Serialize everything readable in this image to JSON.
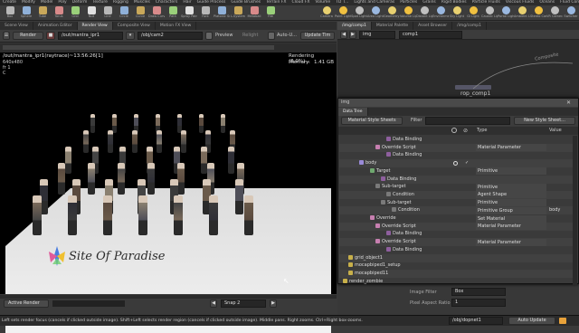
{
  "shelf_tabs": [
    "Create",
    "Modify",
    "Model",
    "Poly",
    "Deform",
    "Texture",
    "Rigging",
    "Muscles",
    "Characters",
    "Hair",
    "Guide Process",
    "Guide Brushes",
    "Terrain FX",
    "Cloud FX",
    "Volume",
    "TD T...",
    "Lights and Cameras",
    "Particles",
    "Grains",
    "Rigid Bodies",
    "Particle Fluids",
    "Viscous Fluids",
    "Oceans",
    "Fluid Containers",
    "Populate Containers",
    "Container Tools",
    "Pyro FX",
    "Cloth",
    "Solid",
    "Wires",
    "Crowds",
    "Drive Simulation"
  ],
  "left_tools": [
    "Box",
    "Sphere",
    "Tube",
    "Torus",
    "Grid",
    "Null",
    "Line",
    "Circle",
    "Curve",
    "Draw Curve",
    "Path",
    "Spray Paint",
    "Font",
    "Platonic Solids",
    "L-System",
    "Metaball",
    "File"
  ],
  "right_tools": [
    "Camera",
    "Point Light",
    "Spot Light",
    "Area Light",
    "Geometry Light",
    "Volume Light",
    "Distant Light",
    "Environment Light",
    "Sky Light",
    "GI Light",
    "Caustic Light",
    "Portal Light",
    "Ambient Light",
    "Stereo Camera",
    "VR Camera",
    "Switcher"
  ],
  "left_tabs": [
    "Scene View",
    "Animation Editor",
    "Render View",
    "Composite View",
    "Motion FX View"
  ],
  "right_tabs": [
    "/img/comp1",
    "Material Palette",
    "Asset Browser",
    "/img/comp1"
  ],
  "render_toolbar": {
    "render_label": "Render",
    "rop_path": "/out/mantra_ipr1",
    "cam_path": "/obj/cam2",
    "preview_label": "Preview",
    "relight_label": "Relight",
    "autoupdate_label": "Auto-U...",
    "update_time_label": "Update Tim"
  },
  "render_info": {
    "title": "/out/mantra_ipr1(raytrace)~13:56:26[1]",
    "res": "640x480",
    "frame": "fr 1",
    "channel": "C",
    "status": "Rendering (0.0%)...",
    "memory_label": "Memory:",
    "memory_value": "1.41 GB"
  },
  "watermark": {
    "text": "Site Of Paradise"
  },
  "render_bottom": {
    "active_render": "Active Render",
    "snap": "Snap 2"
  },
  "network": {
    "path_img": "img",
    "path_comp": "comp1",
    "node_label": "rop_comp1",
    "right_label": "Composite"
  },
  "datatree": {
    "window_title": "Data Tree",
    "path_label": "img",
    "tab_label": "Data Tree",
    "mode_label": "Material Style Sheets",
    "filter_label": "Filter",
    "new_button": "New Style Sheet...",
    "col_type": "Type",
    "col_value": "Value",
    "rows": [
      {
        "label": "Data Binding",
        "indent": 52,
        "type": "",
        "value": "",
        "glyph": "#8e5f9e"
      },
      {
        "label": "Override Script",
        "indent": 40,
        "type": "Material Parameter",
        "value": "",
        "glyph": "#c77fb0"
      },
      {
        "label": "Data Binding",
        "indent": 52,
        "type": "",
        "value": "",
        "glyph": "#8e5f9e"
      },
      {
        "label": "body",
        "indent": 22,
        "type": "",
        "value": "",
        "glyph": "#9a8ad8"
      },
      {
        "label": "Target",
        "indent": 34,
        "type": "Primitive",
        "value": "",
        "glyph": "#6fa86f"
      },
      {
        "label": "Data Binding",
        "indent": 46,
        "type": "",
        "value": "",
        "glyph": "#8e5f9e"
      },
      {
        "label": "Sub-target",
        "indent": 40,
        "type": "Primitive",
        "value": "",
        "glyph": "#7a7a7a"
      },
      {
        "label": "Condition",
        "indent": 52,
        "type": "Agent Shape",
        "value": "",
        "glyph": "#7a7a7a"
      },
      {
        "label": "Sub-target",
        "indent": 46,
        "type": "Primitive",
        "value": "",
        "glyph": "#7a7a7a"
      },
      {
        "label": "Condition",
        "indent": 58,
        "type": "Primitive Group",
        "value": "body",
        "glyph": "#7a7a7a"
      },
      {
        "label": "Override",
        "indent": 34,
        "type": "Set Material",
        "value": "",
        "glyph": "#c77fb0"
      },
      {
        "label": "Override Script",
        "indent": 40,
        "type": "Material Parameter",
        "value": "",
        "glyph": "#c77fb0"
      },
      {
        "label": "Data Binding",
        "indent": 52,
        "type": "",
        "value": "",
        "glyph": "#8e5f9e"
      },
      {
        "label": "Override Script",
        "indent": 40,
        "type": "Material Parameter",
        "value": "",
        "glyph": "#c77fb0"
      },
      {
        "label": "Data Binding",
        "indent": 52,
        "type": "",
        "value": "",
        "glyph": "#8e5f9e"
      },
      {
        "label": "grid_object1",
        "indent": 10,
        "type": "",
        "value": "",
        "glyph": "#c8b04a"
      },
      {
        "label": "mocapbiped1_setup",
        "indent": 10,
        "type": "",
        "value": "",
        "glyph": "#c8b04a"
      },
      {
        "label": "mocapbiped11",
        "indent": 10,
        "type": "",
        "value": "",
        "glyph": "#c8b04a"
      },
      {
        "label": "render_zombie",
        "indent": 4,
        "type": "",
        "value": "",
        "glyph": "#c8b04a"
      }
    ]
  },
  "params": {
    "image_filter_label": "Image Filter",
    "image_filter_value": "Box",
    "pixel_aspect_label": "Pixel Aspect Ratio",
    "pixel_aspect_value": "1"
  },
  "status": {
    "message": "Left sets render focus (cancels if clicked outside image). Shift+Left selects render region (cancels if clicked outside image). Middle pans. Right zooms. Ctrl+Right box-zooms.",
    "path": "/obj/dopnet1",
    "auto_update": "Auto Update"
  },
  "colors": {
    "accent": "#e8a23a",
    "render_bg": "#000000",
    "floor": "#e8e8e8",
    "panel": "#3a3a3a"
  }
}
